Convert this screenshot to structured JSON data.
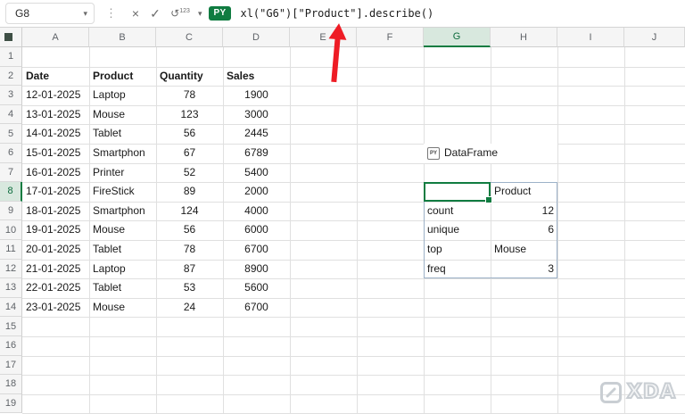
{
  "formula_bar": {
    "name_box_value": "G8",
    "icons": {
      "name_box_chevron": "▾",
      "options_dots": "⋮",
      "cancel": "×",
      "enter": "✓",
      "output_arrow": "↺",
      "output_123": "123",
      "py_chevron": "▾"
    },
    "py_badge": "PY",
    "formula": "xl(\"G6\")[\"Product\"].describe()"
  },
  "grid": {
    "column_headers": [
      "A",
      "B",
      "C",
      "D",
      "E",
      "F",
      "G",
      "H",
      "I",
      "J"
    ],
    "row_headers": [
      "1",
      "2",
      "3",
      "4",
      "5",
      "6",
      "7",
      "8",
      "9",
      "10",
      "11",
      "12",
      "13",
      "14",
      "15",
      "16",
      "17",
      "18",
      "19"
    ],
    "selected_column": "G",
    "selected_row": "8",
    "active_cell": "G8"
  },
  "data_table": {
    "headers": [
      "Date",
      "Product",
      "Quantity",
      "Sales"
    ],
    "rows": [
      [
        "12-01-2025",
        "Laptop",
        "78",
        "1900"
      ],
      [
        "13-01-2025",
        "Mouse",
        "123",
        "3000"
      ],
      [
        "14-01-2025",
        "Tablet",
        "56",
        "2445"
      ],
      [
        "15-01-2025",
        "Smartphon",
        "67",
        "6789"
      ],
      [
        "16-01-2025",
        "Printer",
        "52",
        "5400"
      ],
      [
        "17-01-2025",
        "FireStick",
        "89",
        "2000"
      ],
      [
        "18-01-2025",
        "Smartphon",
        "124",
        "4000"
      ],
      [
        "19-01-2025",
        "Mouse",
        "56",
        "6000"
      ],
      [
        "20-01-2025",
        "Tablet",
        "78",
        "6700"
      ],
      [
        "21-01-2025",
        "Laptop",
        "87",
        "8900"
      ],
      [
        "22-01-2025",
        "Tablet",
        "53",
        "5600"
      ],
      [
        "23-01-2025",
        "Mouse",
        "24",
        "6700"
      ]
    ]
  },
  "dataframe_cell": {
    "badge": "PY",
    "label": "DataFrame"
  },
  "describe_table": {
    "value_header": "Product",
    "rows": [
      {
        "label": "count",
        "value": "12"
      },
      {
        "label": "unique",
        "value": "6"
      },
      {
        "label": "top",
        "value": "Mouse"
      },
      {
        "label": "freq",
        "value": "3"
      }
    ]
  },
  "watermark": {
    "text": "XDA"
  },
  "colors": {
    "accent_green": "#107C41",
    "arrow_red": "#EE1C25",
    "spill_border": "#9DB2C8",
    "gridline": "#E0E0E0"
  }
}
